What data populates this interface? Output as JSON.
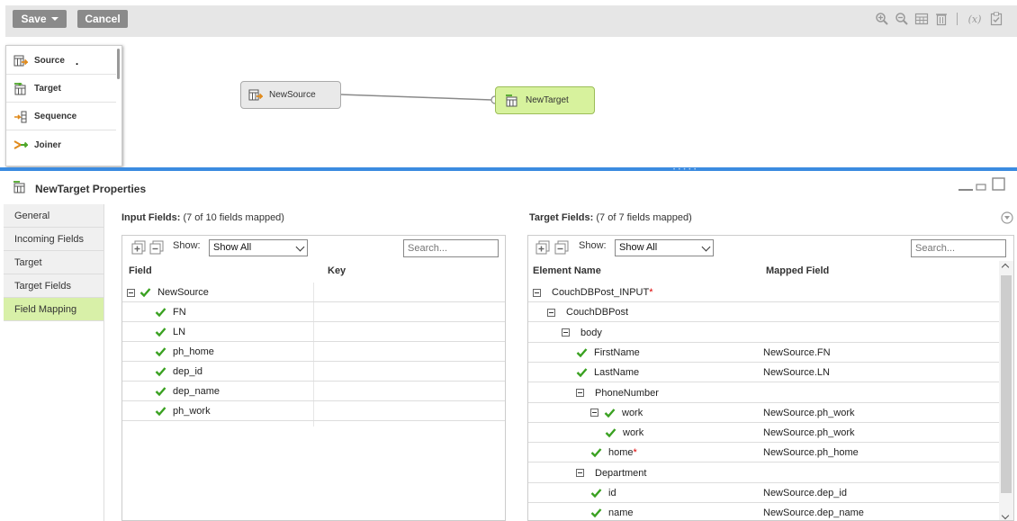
{
  "toolbar": {
    "save_label": "Save",
    "cancel_label": "Cancel",
    "icons": [
      "zoom-in-icon",
      "zoom-out-icon",
      "grid-icon",
      "delete-icon",
      "expression-icon",
      "validate-icon"
    ],
    "fx_label": "(x)"
  },
  "palette": {
    "items": [
      {
        "label": "Source",
        "icon": "source-icon"
      },
      {
        "label": "Target",
        "icon": "target-icon"
      },
      {
        "label": "Sequence",
        "icon": "sequence-icon"
      },
      {
        "label": "Joiner",
        "icon": "joiner-icon"
      }
    ],
    "dot": "."
  },
  "canvas": {
    "source_node": "NewSource",
    "target_node": "NewTarget"
  },
  "properties": {
    "title": "NewTarget Properties",
    "nav": [
      "General",
      "Incoming Fields",
      "Target",
      "Target Fields",
      "Field Mapping"
    ],
    "active_nav": "Field Mapping"
  },
  "input_fields": {
    "title": "Input Fields:",
    "summary": "(7 of 10 fields mapped)",
    "show_label": "Show:",
    "show_value": "Show All",
    "search_placeholder": "Search...",
    "col_field": "Field",
    "col_key": "Key",
    "rows": [
      {
        "name": "NewSource",
        "level": 0,
        "expand": true,
        "check": true
      },
      {
        "name": "FN",
        "level": 1,
        "check": true
      },
      {
        "name": "LN",
        "level": 1,
        "check": true
      },
      {
        "name": "ph_home",
        "level": 1,
        "check": true
      },
      {
        "name": "dep_id",
        "level": 1,
        "check": true
      },
      {
        "name": "dep_name",
        "level": 1,
        "check": true
      },
      {
        "name": "ph_work",
        "level": 1,
        "check": true
      }
    ]
  },
  "target_fields": {
    "title": "Target Fields:",
    "summary": "(7 of 7 fields mapped)",
    "show_label": "Show:",
    "show_value": "Show All",
    "search_placeholder": "Search...",
    "col_element": "Element Name",
    "col_mapped": "Mapped Field",
    "required_mark": "*",
    "rows": [
      {
        "name": "CouchDBPost_INPUT",
        "required": true,
        "level": 0,
        "expand": true,
        "check": false,
        "mapped": ""
      },
      {
        "name": "CouchDBPost",
        "level": 1,
        "expand": true,
        "check": false,
        "mapped": ""
      },
      {
        "name": "body",
        "level": 2,
        "expand": true,
        "check": false,
        "mapped": ""
      },
      {
        "name": "FirstName",
        "level": 3,
        "expand": false,
        "check": true,
        "mapped": "NewSource.FN"
      },
      {
        "name": "LastName",
        "level": 3,
        "expand": false,
        "check": true,
        "mapped": "NewSource.LN"
      },
      {
        "name": "PhoneNumber",
        "level": 3,
        "expand": true,
        "check": false,
        "mapped": ""
      },
      {
        "name": "work",
        "level": 4,
        "expand": true,
        "check": true,
        "mapped": "NewSource.ph_work"
      },
      {
        "name": "work",
        "level": 5,
        "expand": false,
        "check": true,
        "mapped": "NewSource.ph_work"
      },
      {
        "name": "home",
        "required": true,
        "level": 4,
        "expand": false,
        "check": true,
        "mapped": "NewSource.ph_home"
      },
      {
        "name": "Department",
        "level": 3,
        "expand": true,
        "check": false,
        "mapped": ""
      },
      {
        "name": "id",
        "level": 4,
        "expand": false,
        "check": true,
        "mapped": "NewSource.dep_id"
      },
      {
        "name": "name",
        "level": 4,
        "expand": false,
        "check": true,
        "mapped": "NewSource.dep_name"
      }
    ]
  },
  "colors": {
    "accent_blue": "#3b8be0",
    "target_node": "#d7f29d",
    "active_nav": "#d8f0a8",
    "check_green": "#3aa121"
  }
}
